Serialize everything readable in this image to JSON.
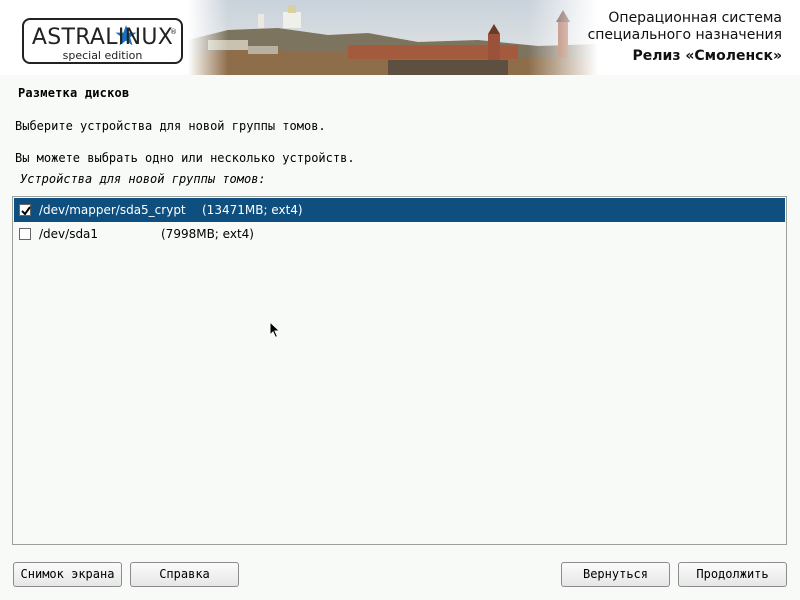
{
  "header": {
    "logo_main": "ASTRALINUX",
    "logo_reg": "®",
    "logo_sub": "special edition",
    "title_line1": "Операционная система",
    "title_line2": "специального назначения",
    "title_line3": "Релиз «Смоленск»"
  },
  "page": {
    "title": "Разметка дисков",
    "instruction1": "Выберите устройства для новой группы томов.",
    "instruction2": "Вы можете выбрать одно или несколько устройств.",
    "list_label": "Устройства для новой группы томов:"
  },
  "devices": [
    {
      "device": "/dev/mapper/sda5_crypt",
      "info": "(13471MB; ext4)",
      "checked": true,
      "selected": true
    },
    {
      "device": "/dev/sda1",
      "info": "(7998MB; ext4)",
      "checked": false,
      "selected": false
    }
  ],
  "buttons": {
    "screenshot": "Снимок экрана",
    "help": "Справка",
    "back": "Вернуться",
    "continue": "Продолжить"
  },
  "colors": {
    "selection": "#0f4f7f",
    "star": "#1a6fc0",
    "background": "#f7faf7"
  }
}
